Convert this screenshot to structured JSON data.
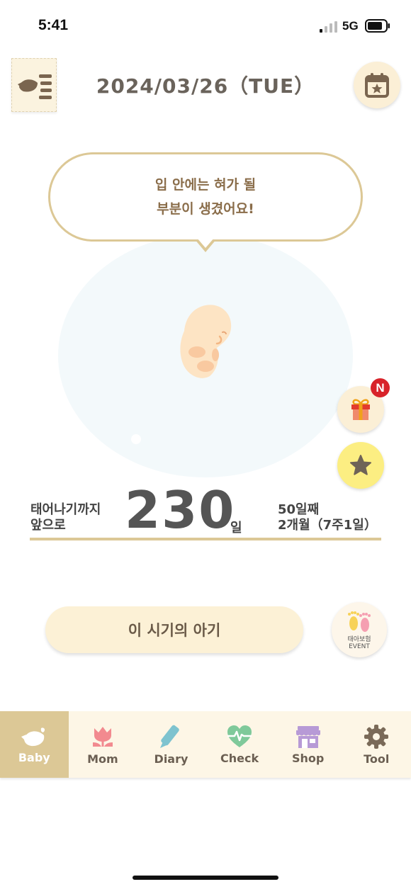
{
  "status_bar": {
    "time": "5:41",
    "network": "5G"
  },
  "header": {
    "date": "2024/03/26（TUE）"
  },
  "message": {
    "line1": "입 안에는 혀가 될",
    "line2": "부분이 생겼어요!"
  },
  "gift": {
    "badge": "N"
  },
  "countdown": {
    "label_line1": "태어나기까지",
    "label_line2": "앞으로",
    "days_left": "230",
    "unit": "일",
    "day_count": "50일째",
    "term": "2개월（7주1일）"
  },
  "period_button": {
    "label": "이 시기의 아기"
  },
  "event": {
    "line1": "태아보험",
    "line2": "EVENT"
  },
  "tabs": [
    {
      "label": "Baby",
      "icon": "bird-icon",
      "color": "#ffffff",
      "active": true
    },
    {
      "label": "Mom",
      "icon": "tulip-icon",
      "color": "#f28a8f"
    },
    {
      "label": "Diary",
      "icon": "pen-icon",
      "color": "#7ec3cf"
    },
    {
      "label": "Check",
      "icon": "heart-pulse-icon",
      "color": "#7fc99a"
    },
    {
      "label": "Shop",
      "icon": "shop-icon",
      "color": "#b79ad6"
    },
    {
      "label": "Tool",
      "icon": "gear-icon",
      "color": "#7a6a58"
    }
  ],
  "colors": {
    "accent": "#dcc896",
    "badge": "#d8232a",
    "star_button": "#fcee82"
  }
}
